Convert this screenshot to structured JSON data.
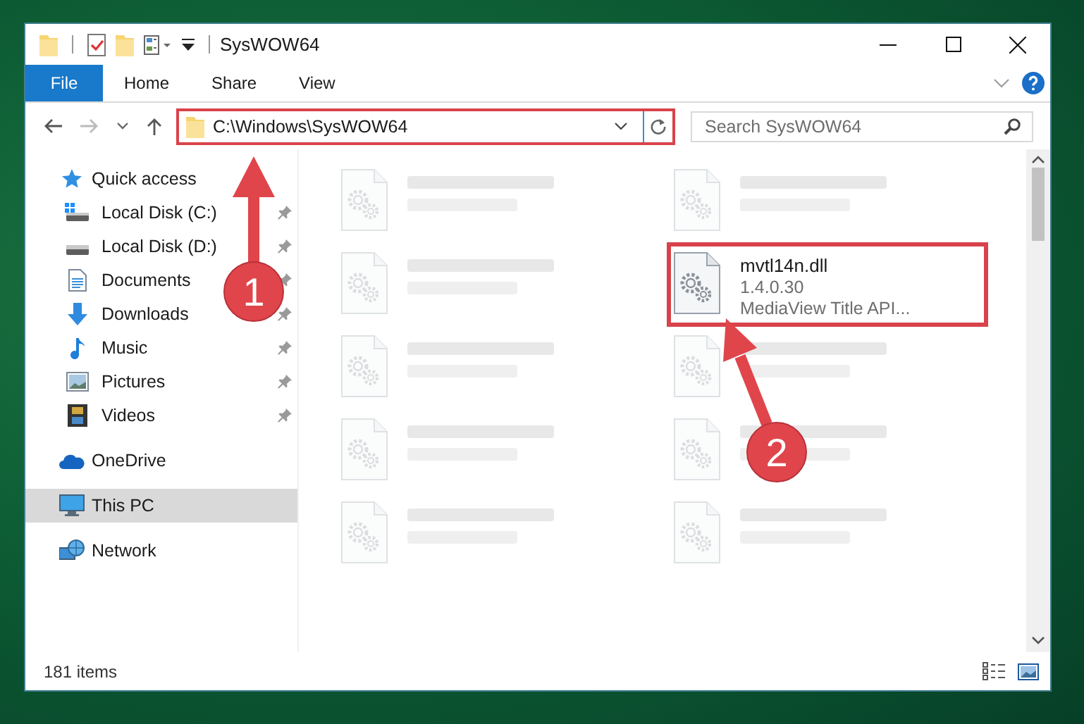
{
  "window": {
    "title": "SysWOW64"
  },
  "ribbon": {
    "tabs": [
      {
        "label": "File",
        "kind": "menu",
        "selected": false
      },
      {
        "label": "Home",
        "kind": "tab",
        "selected": false
      },
      {
        "label": "Share",
        "kind": "tab",
        "selected": false
      },
      {
        "label": "View",
        "kind": "tab",
        "selected": false
      }
    ]
  },
  "address_bar": {
    "path": "C:\\Windows\\SysWOW64",
    "highlighted": true
  },
  "search": {
    "placeholder": "Search SysWOW64"
  },
  "navigation": [
    {
      "label": "Quick access",
      "kind": "star",
      "selected": false,
      "children": [
        {
          "label": "Local Disk (C:)",
          "kind": "system-drive",
          "pinned": true,
          "selected": false
        },
        {
          "label": "Local Disk (D:)",
          "kind": "drive",
          "pinned": true,
          "selected": false
        },
        {
          "label": "Documents",
          "kind": "documents",
          "pinned": true,
          "selected": false
        },
        {
          "label": "Downloads",
          "kind": "downloads",
          "pinned": true,
          "selected": false
        },
        {
          "label": "Music",
          "kind": "music",
          "pinned": true,
          "selected": false
        },
        {
          "label": "Pictures",
          "kind": "pictures",
          "pinned": true,
          "selected": false
        },
        {
          "label": "Videos",
          "kind": "videos",
          "pinned": true,
          "selected": false
        }
      ]
    },
    {
      "label": "OneDrive",
      "kind": "cloud",
      "selected": false
    },
    {
      "label": "This PC",
      "kind": "computer",
      "selected": true
    },
    {
      "label": "Network",
      "kind": "network",
      "selected": false
    }
  ],
  "files": [
    {
      "blurred": true,
      "highlighted": false
    },
    {
      "blurred": true,
      "highlighted": false
    },
    {
      "blurred": true,
      "highlighted": false
    },
    {
      "name": "mvtl14n.dll",
      "lines": [
        "1.4.0.30",
        "MediaView Title API..."
      ],
      "blurred": false,
      "highlighted": true
    },
    {
      "blurred": true,
      "highlighted": false
    },
    {
      "blurred": true,
      "highlighted": false
    },
    {
      "blurred": true,
      "highlighted": false
    },
    {
      "blurred": true,
      "highlighted": false
    },
    {
      "blurred": true,
      "highlighted": false
    },
    {
      "blurred": true,
      "highlighted": false
    }
  ],
  "status_bar": {
    "item_count": "181 items"
  },
  "annotations": [
    {
      "label": "1"
    },
    {
      "label": "2"
    }
  ]
}
